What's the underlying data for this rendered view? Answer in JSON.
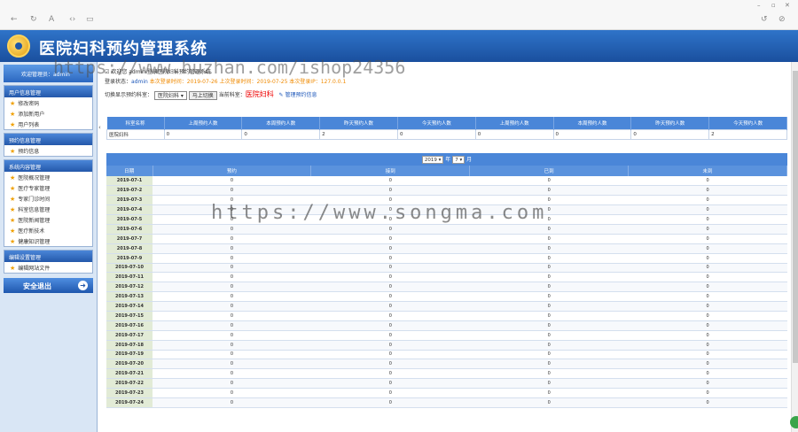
{
  "browser": {
    "nav_icons": [
      "back-arrow-icon",
      "refresh-icon",
      "font-icon",
      "code-icon",
      "page-icon"
    ],
    "window_icons": [
      "minimize-icon",
      "maximize-icon",
      "close-icon"
    ]
  },
  "header": {
    "title": "医院妇科预约管理系统"
  },
  "sidebar": {
    "welcome": "欢迎管理员：admin",
    "groups": [
      {
        "title": "用户信息管理",
        "items": [
          "修改密码",
          "添加新用户",
          "用户列表"
        ]
      },
      {
        "title": "预约信息管理",
        "items": [
          "预约信息"
        ]
      },
      {
        "title": "系统内容管理",
        "items": [
          "医院概况管理",
          "医疗专家管理",
          "专家门诊时间",
          "科室信息管理",
          "医院新闻管理",
          "医疗新技术",
          "健康知识管理"
        ]
      },
      {
        "title": "编辑设置管理",
        "items": [
          "编辑网站文件"
        ]
      }
    ],
    "logout": "安全退出"
  },
  "main": {
    "line1": "欢迎您 admin 登录医院妇科预约管理系统",
    "line2_label": "登录状态：",
    "line2_user": "admin",
    "line2_rest": "本次登录时间：2019-07-26 上次登录时间：2019-07-25 本次登录IP：127.0.0.1",
    "line3_label": "切换显示预约科室：",
    "dept_select": "医院妇科",
    "switch_button": "马上切换",
    "current_label": "当前科室：",
    "current_dept": "医院妇科",
    "link": "管理预约信息"
  },
  "summary": {
    "headers": [
      "科室名称",
      "上周预约人数",
      "本周预约人数",
      "昨天预约人数",
      "今天预约人数",
      "上周预约人数",
      "本周预约人数",
      "昨天预约人数",
      "今天预约人数"
    ],
    "row": [
      "医院妇科",
      "0",
      "0",
      "2",
      "0",
      "0",
      "0",
      "0",
      "2"
    ]
  },
  "calendar": {
    "year": "2019",
    "year_suffix": "年",
    "month": "7",
    "month_suffix": "月"
  },
  "days": {
    "headers": [
      "日期",
      "预约",
      "接到",
      "已到",
      "未到"
    ],
    "rows": [
      [
        "2019-07-1",
        "0",
        "0",
        "0",
        "0"
      ],
      [
        "2019-07-2",
        "0",
        "0",
        "0",
        "0"
      ],
      [
        "2019-07-3",
        "0",
        "0",
        "0",
        "0"
      ],
      [
        "2019-07-4",
        "0",
        "0",
        "0",
        "0"
      ],
      [
        "2019-07-5",
        "0",
        "0",
        "0",
        "0"
      ],
      [
        "2019-07-6",
        "0",
        "0",
        "0",
        "0"
      ],
      [
        "2019-07-7",
        "0",
        "0",
        "0",
        "0"
      ],
      [
        "2019-07-8",
        "0",
        "0",
        "0",
        "0"
      ],
      [
        "2019-07-9",
        "0",
        "0",
        "0",
        "0"
      ],
      [
        "2019-07-10",
        "0",
        "0",
        "0",
        "0"
      ],
      [
        "2019-07-11",
        "0",
        "0",
        "0",
        "0"
      ],
      [
        "2019-07-12",
        "0",
        "0",
        "0",
        "0"
      ],
      [
        "2019-07-13",
        "0",
        "0",
        "0",
        "0"
      ],
      [
        "2019-07-14",
        "0",
        "0",
        "0",
        "0"
      ],
      [
        "2019-07-15",
        "0",
        "0",
        "0",
        "0"
      ],
      [
        "2019-07-16",
        "0",
        "0",
        "0",
        "0"
      ],
      [
        "2019-07-17",
        "0",
        "0",
        "0",
        "0"
      ],
      [
        "2019-07-18",
        "0",
        "0",
        "0",
        "0"
      ],
      [
        "2019-07-19",
        "0",
        "0",
        "0",
        "0"
      ],
      [
        "2019-07-20",
        "0",
        "0",
        "0",
        "0"
      ],
      [
        "2019-07-21",
        "0",
        "0",
        "0",
        "0"
      ],
      [
        "2019-07-22",
        "0",
        "0",
        "0",
        "0"
      ],
      [
        "2019-07-23",
        "0",
        "0",
        "0",
        "0"
      ],
      [
        "2019-07-24",
        "0",
        "0",
        "0",
        "0"
      ]
    ]
  },
  "watermarks": {
    "top": "https://www.huzhan.com/ishop24356",
    "middle": "https://www.songma.com"
  }
}
